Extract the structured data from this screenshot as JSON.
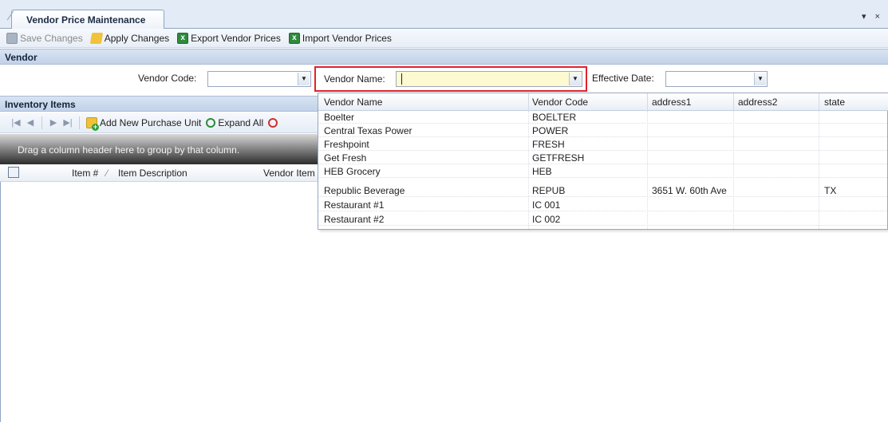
{
  "tab": {
    "title": "Vendor Price Maintenance",
    "controls": "▾ ×"
  },
  "toolbar": {
    "save_label": "Save Changes",
    "apply_label": "Apply Changes",
    "export_label": "Export Vendor Prices",
    "import_label": "Import Vendor Prices"
  },
  "vendor_section": {
    "title": "Vendor",
    "vendor_code_label": "Vendor Code:",
    "vendor_code_value": "",
    "vendor_name_label": "Vendor Name:",
    "vendor_name_value": "",
    "effective_date_label": "Effective Date:",
    "effective_date_value": ""
  },
  "inventory_section": {
    "title": "Inventory Items",
    "nav": {
      "first": "|◀",
      "prev": "◀",
      "next": "▶",
      "last": "▶|"
    },
    "add_purchase_unit_label": "Add New Purchase Unit",
    "expand_all_label": "Expand All",
    "group_panel_text": "Drag a column header here to group by that column.",
    "columns": [
      "Item #",
      "Item Description",
      "Vendor Item"
    ]
  },
  "dropdown": {
    "columns": [
      "Vendor Name",
      "Vendor Code",
      "address1",
      "address2",
      "state"
    ],
    "rows": [
      [
        "Boelter",
        "BOELTER",
        "",
        "",
        ""
      ],
      [
        "Central Texas Power",
        "POWER",
        "",
        "",
        ""
      ],
      [
        "Freshpoint",
        "FRESH",
        "",
        "",
        ""
      ],
      [
        "Get Fresh",
        "GETFRESH",
        "",
        "",
        ""
      ],
      [
        "HEB Grocery",
        "HEB",
        "",
        "",
        ""
      ],
      [
        "Republic Beverage",
        "REPUB",
        "3651 W. 60th Ave",
        "",
        "TX"
      ],
      [
        "Restaurant #1",
        "IC 001",
        "",
        "",
        ""
      ],
      [
        "Restaurant #2",
        "IC 002",
        "",
        "",
        ""
      ]
    ]
  },
  "colors": {
    "highlight_border": "#e0232b",
    "active_input": "#fdf9d0",
    "header_blue": "#c2d2e8"
  }
}
